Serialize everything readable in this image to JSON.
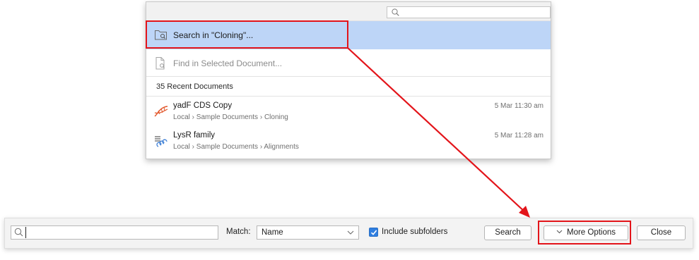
{
  "popup": {
    "search_placeholder": "",
    "search_in_label": "Search in \"Cloning\"...",
    "find_in_label": "Find in Selected Document...",
    "recent_header": "35 Recent Documents",
    "recent": [
      {
        "title": "yadF CDS Copy",
        "path": "Local › Sample Documents › Cloning",
        "date": "5 Mar 11:30 am",
        "icon": "dna-sequence-icon"
      },
      {
        "title": "LysR family",
        "path": "Local › Sample Documents › Alignments",
        "date": "5 Mar 11:28 am",
        "icon": "alignment-icon"
      }
    ]
  },
  "toolbar": {
    "search_value": "",
    "match_label": "Match:",
    "match_value": "Name",
    "include_subfolders_label": "Include subfolders",
    "include_subfolders_checked": true,
    "search_button": "Search",
    "more_options_button": "More Options",
    "close_button": "Close"
  },
  "colors": {
    "highlight_row": "#bdd5f7",
    "annotation_red": "#e3141a",
    "checkbox_blue": "#2f7ee0"
  }
}
